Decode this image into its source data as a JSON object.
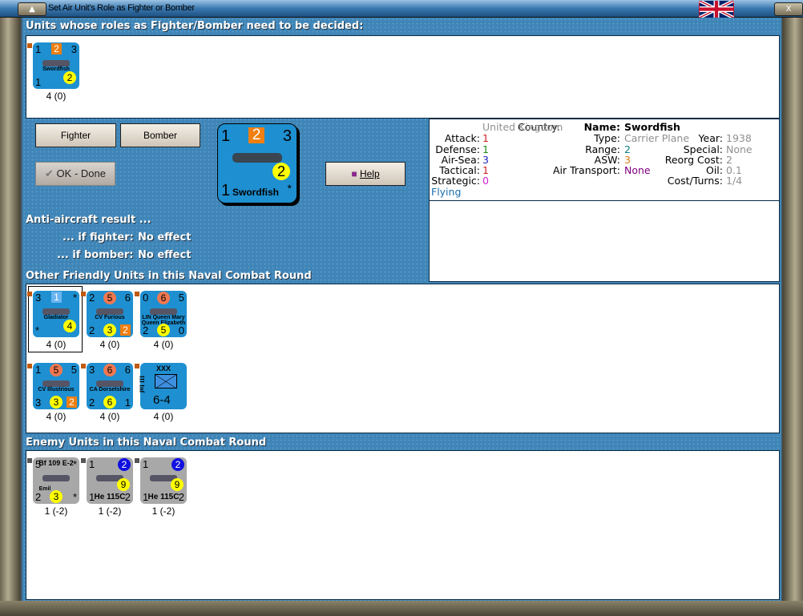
{
  "window": {
    "title": "Set Air Unit's Role as Fighter or Bomber",
    "flag": "united-kingdom-flag"
  },
  "sections": {
    "pending": "Units whose roles as Fighter/Bomber need to be decided:",
    "friendly": "Other Friendly Units in this Naval Combat Round",
    "enemy": "Enemy Units in this Naval Combat Round"
  },
  "buttons": {
    "fighter": "Fighter",
    "bomber": "Bomber",
    "ok": "OK - Done",
    "help": "Help"
  },
  "aa": {
    "title": "Anti-aircraft result ...",
    "fighter_label": "... if fighter:",
    "fighter_value": "No effect",
    "bomber_label": "... if bomber:",
    "bomber_value": "No effect"
  },
  "selected": {
    "tl": "1",
    "tm": "2",
    "tr": "3",
    "br": "2",
    "bl": "1",
    "name": "Swordfish",
    "star": "*"
  },
  "info": {
    "country_label": "Country:",
    "country": "United Kingdom",
    "attack_label": "Attack:",
    "attack": "1",
    "defense_label": "Defense:",
    "defense": "1",
    "airsea_label": "Air-Sea:",
    "airsea": "3",
    "tactical_label": "Tactical:",
    "tactical": "1",
    "strategic_label": "Strategic:",
    "strategic": "0",
    "status": "Flying",
    "name_label": "Name:",
    "name": "Swordfish",
    "type_label": "Type:",
    "type": "Carrier Plane",
    "range_label": "Range:",
    "range": "2",
    "asw_label": "ASW:",
    "asw": "3",
    "airtransport_label": "Air Transport:",
    "airtransport": "None",
    "year_label": "Year:",
    "year": "1938",
    "special_label": "Special:",
    "special": "None",
    "reorg_label": "Reorg Cost:",
    "reorg": "2",
    "oil_label": "Oil:",
    "oil": "0.1",
    "cost_label": "Cost/Turns:",
    "cost": "1/4"
  },
  "colors": {
    "friendly": "#1e8fd0",
    "enemy": "#a8a8a8",
    "attack": "#d02020",
    "defense": "#1a8a1a",
    "airsea": "#2020c0",
    "asw": "#e07a10",
    "strategic": "#d020d0",
    "airtransport": "#800080",
    "range": "#108080",
    "flying": "#1a6eb0"
  },
  "pending_units": [
    {
      "tl": "1",
      "tm": "2",
      "tmstyle": "orange",
      "tr": "3",
      "name": "Swordfish",
      "bl": "1",
      "bm": "",
      "br": "2",
      "brstyle": "yellow-mid",
      "below": "4 (0)",
      "side": "friendly"
    }
  ],
  "friendly_units": [
    {
      "tl": "3",
      "tm": "1",
      "tmstyle": "lightblue",
      "tr": "*",
      "name": "Gladiator",
      "bl": "*",
      "bm": "",
      "br": "4",
      "brstyle": "yellow-mid",
      "below": "4 (0)",
      "side": "friendly",
      "selected": true
    },
    {
      "tl": "2",
      "tm": "5",
      "tmstyle": "red",
      "tr": "6",
      "name": "CV Furious",
      "bl": "2",
      "bm": "3",
      "br": "2",
      "brstyle": "orange",
      "below": "4 (0)",
      "side": "friendly"
    },
    {
      "tl": "0",
      "tm": "6",
      "tmstyle": "red",
      "tr": "5",
      "name": "LIN Queen Mary Queen Elizabeth",
      "bl": "2",
      "bm": "5",
      "br": "0",
      "below": "4 (0)",
      "side": "friendly"
    },
    {
      "tl": "1",
      "tm": "5",
      "tmstyle": "red",
      "tr": "5",
      "name": "CV Illustrious",
      "bl": "3",
      "bm": "3",
      "br": "2",
      "brstyle": "orange",
      "below": "4 (0)",
      "side": "friendly"
    },
    {
      "tl": "3",
      "tm": "6",
      "tmstyle": "red",
      "tr": "6",
      "name": "CA Dorsetshire",
      "bl": "2",
      "bm": "6",
      "br": "1",
      "below": "4 (0)",
      "side": "friendly"
    },
    {
      "tl": "",
      "tm": "XXX",
      "tmstyle": "text",
      "tr": "",
      "name": "III Inf",
      "bl": "",
      "bm": "6-4",
      "br": "",
      "below": "4 (0)",
      "side": "friendly",
      "army": true
    }
  ],
  "enemy_units": [
    {
      "tl": "5",
      "tm": "Bf 109 E-2",
      "tmstyle": "text",
      "tr": "*",
      "name": "Emil",
      "bl": "2",
      "bm": "3",
      "br": "*",
      "below": "1 (-2)",
      "side": "enemy"
    },
    {
      "tl": "1",
      "tm": "",
      "tr": "2",
      "trstyle": "blue",
      "name": "He 115C",
      "bl": "1",
      "bm": "",
      "br": "2",
      "mid": "9",
      "below": "1 (-2)",
      "side": "enemy"
    },
    {
      "tl": "1",
      "tm": "",
      "tr": "2",
      "trstyle": "blue",
      "name": "He 115C",
      "bl": "1",
      "bm": "",
      "br": "2",
      "mid": "9",
      "below": "1 (-2)",
      "side": "enemy"
    }
  ]
}
